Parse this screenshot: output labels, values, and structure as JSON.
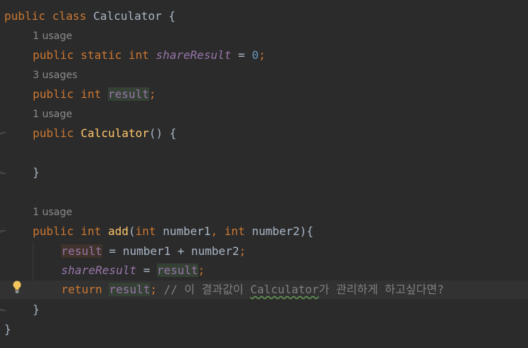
{
  "colors": {
    "background": "#2b2b2b",
    "keyword": "#cc7832",
    "function": "#ffc66d",
    "number": "#6897bb",
    "field": "#9876aa",
    "plain": "#a9b7c6",
    "comment": "#808080",
    "hint": "#8c8c8c",
    "read_highlight": "#344134",
    "write_highlight": "#40332b"
  },
  "code": {
    "class_decl": {
      "kw1": "public",
      "kw2": "class",
      "name": "Calculator",
      "brace": "{"
    },
    "hint_share_result": "1 usage",
    "share_result_decl": {
      "kw1": "public",
      "kw2": "static",
      "type": "int",
      "field": "shareResult",
      "eq": "=",
      "value": "0",
      "semi": ";"
    },
    "hint_result": "3 usages",
    "result_decl": {
      "kw1": "public",
      "type": "int",
      "field": "result",
      "semi": ";"
    },
    "hint_constructor": "1 usage",
    "constructor_decl": {
      "kw1": "public",
      "name": "Calculator",
      "parens": "()",
      "brace": "{"
    },
    "constructor_close": "}",
    "hint_add": "1 usage",
    "add_decl": {
      "kw1": "public",
      "type": "int",
      "name": "add",
      "open": "(",
      "p1type": "int",
      "p1name": "number1",
      "comma": ",",
      "p2type": "int",
      "p2name": "number2",
      "close": "){"
    },
    "add_line1": {
      "field": "result",
      "expr": " = number1 + number2",
      "semi": ";"
    },
    "add_line2": {
      "field": "shareResult",
      "eq": " = ",
      "field2": "result",
      "semi": ";"
    },
    "add_line3": {
      "kw": "return",
      "field": "result",
      "semi": ";",
      "comment_pre": " // 이 결과값이 ",
      "comment_typo": "Calculator",
      "comment_post": "가 관리하게 하고싶다면?"
    },
    "add_close": "}",
    "class_close": "}"
  },
  "icons": {
    "bulb": "lightbulb-icon",
    "fold": "fold-marker-icon"
  }
}
